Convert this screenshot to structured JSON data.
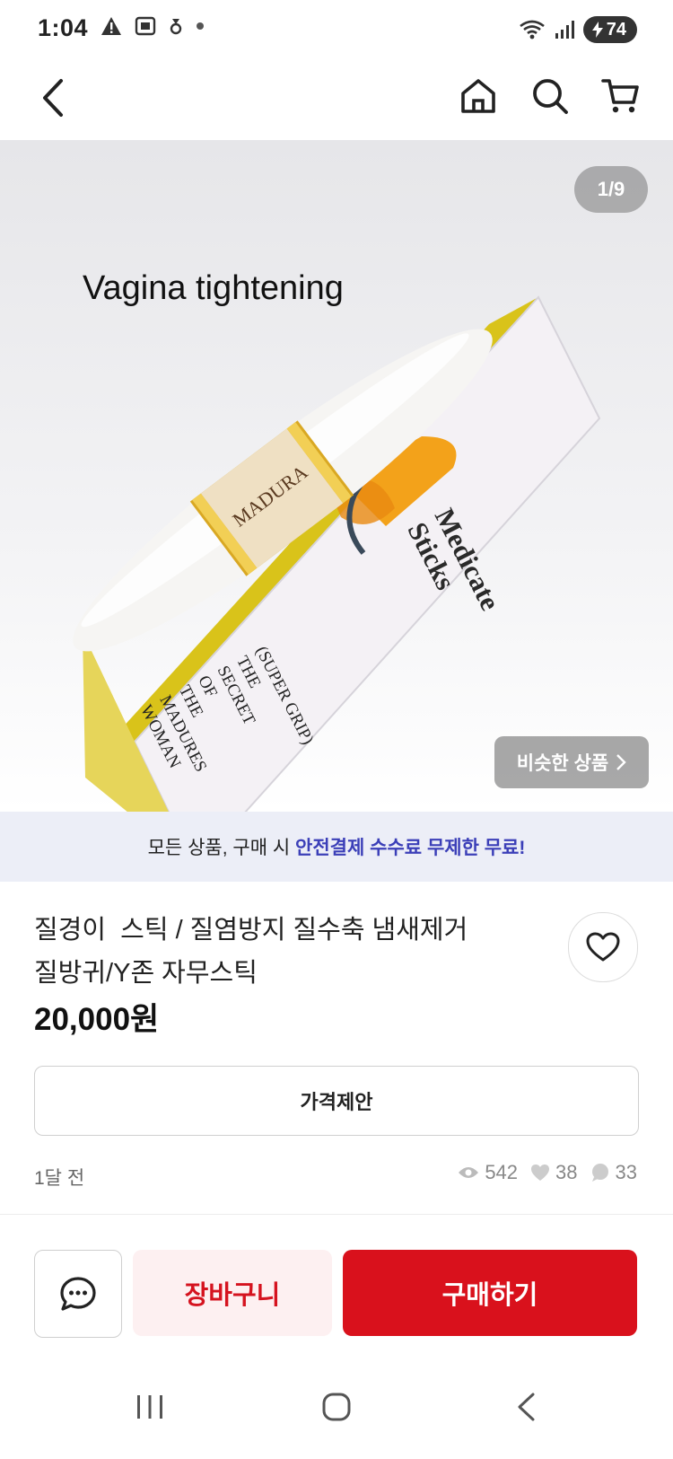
{
  "status_bar": {
    "time": "1:04",
    "battery": "74"
  },
  "nav": {
    "back_icon": "chevron-left-icon",
    "home_icon": "home-icon",
    "search_icon": "search-icon",
    "cart_icon": "cart-icon"
  },
  "hero": {
    "counter": "1/9",
    "caption": "Vagina tightening",
    "box_title": "Medicate Sticks",
    "box_lines": [
      "(SUPER GRIP)",
      "THE",
      "SECRET",
      "OF",
      "THE",
      "MADURES",
      "WOMAN"
    ],
    "similar_label": "비슷한 상품",
    "similar_icon": "chevron-right-icon"
  },
  "banner": {
    "prefix": "모든 상품, 구매 시 ",
    "highlight": "안전결제 수수료 무제한 무료!"
  },
  "product": {
    "title_line1": "질경이  스틱 / 질염방지 질수축 냄새제거",
    "title_line2": "질방귀/Y존 자무스틱",
    "price": "20,000원",
    "offer_label": "가격제안",
    "posted": "1달 전",
    "views": "542",
    "likes": "38",
    "chats": "33"
  },
  "actions": {
    "cart_label": "장바구니",
    "buy_label": "구매하기",
    "chat_icon": "chat-bubble-icon"
  },
  "colors": {
    "accent": "#d9111c",
    "banner_bg": "#eceef7",
    "banner_highlight": "#3b3fb8"
  }
}
